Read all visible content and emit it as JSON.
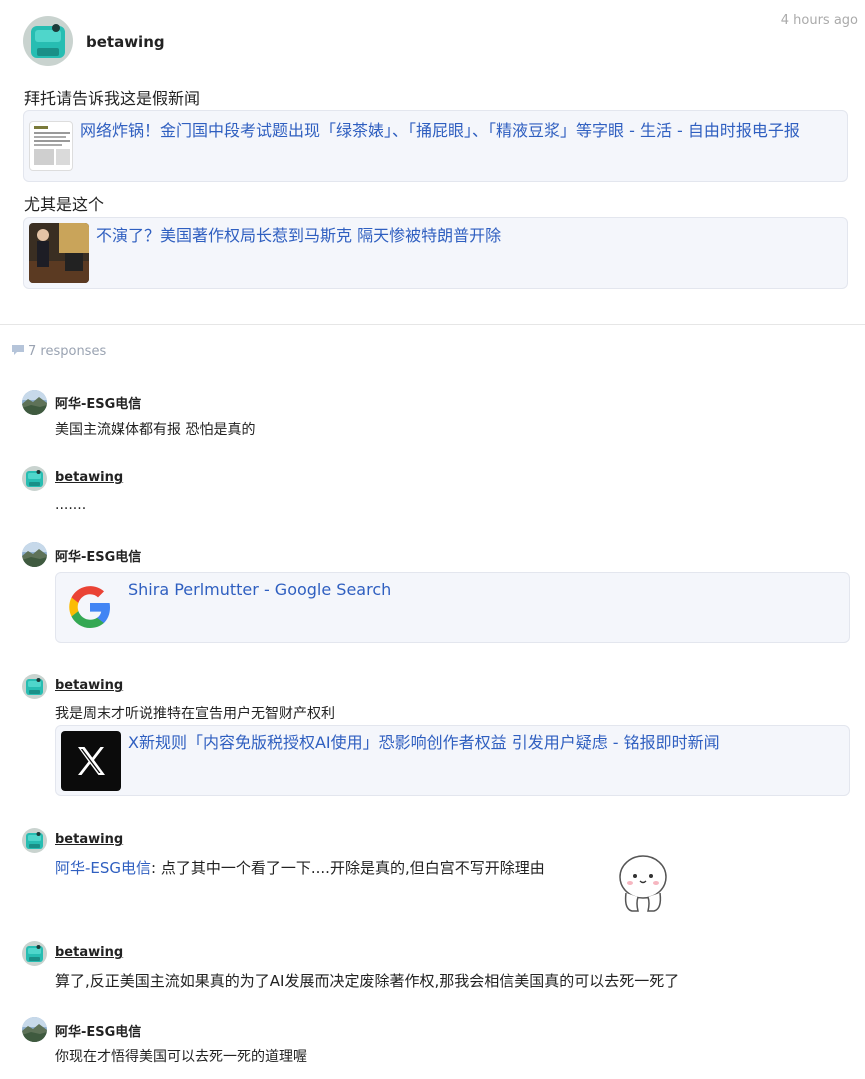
{
  "post": {
    "author": "betawing",
    "time": "4 hours ago",
    "line1": "拜托请告诉我这是假新闻",
    "link1": "网络炸锅！金门国中段考试题出现「绿茶婊」、「捅屁眼」、「精液豆浆」等字眼 - 生活 - 自由时报电子报",
    "line2": "尤其是这个",
    "link2": "不演了？美国著作权局长惹到马斯克 隔天惨被特朗普开除"
  },
  "responses": {
    "count_label": "7 responses"
  },
  "replies": [
    {
      "author": "阿华-ESG电信",
      "text": "美国主流媒体都有报 恐怕是真的"
    },
    {
      "author": "betawing",
      "text": "......."
    },
    {
      "author": "阿华-ESG电信",
      "link": "Shira Perlmutter - Google Search"
    },
    {
      "author": "betawing",
      "text": "我是周末才听说推特在宣告用户无智财产权利",
      "link": "X新规则「内容免版税授权AI使用」恐影响创作者权益 引发用户疑虑 - 铭报即时新闻"
    },
    {
      "author": "betawing",
      "mention": "阿华-ESG电信",
      "text": ": 点了其中一个看了一下....开除是真的,但白宫不写开除理由"
    },
    {
      "author": "betawing",
      "text": "算了,反正美国主流如果真的为了AI发展而决定废除著作权,那我会相信美国真的可以去死一死了"
    },
    {
      "author": "阿华-ESG电信",
      "text": "你现在才悟得美国可以去死一死的道理喔"
    }
  ],
  "icons": [
    "teal-avatar-icon",
    "landscape-avatar-icon",
    "google-g-icon",
    "x-logo-icon",
    "chat-bubble-icon",
    "smiley-sticker-icon"
  ],
  "colors": {
    "link": "#2f5fc0",
    "card_bg": "#f4f6fb",
    "muted": "#9aa3b2",
    "teal": "#2bbfb4"
  }
}
